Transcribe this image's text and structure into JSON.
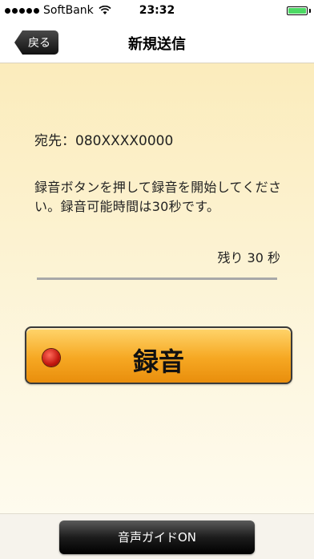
{
  "status_bar": {
    "carrier": "SoftBank",
    "time": "23:32",
    "signal_bars": 5,
    "battery_level": 1.0,
    "battery_color": "#4cd964"
  },
  "nav": {
    "back_label": "戻る",
    "title": "新規送信"
  },
  "main": {
    "recipient": "宛先：080XXXX0000",
    "instructions": "録音ボタンを押して録音を開始してください。録音可能時間は30秒です。",
    "remaining": "残り 30 秒",
    "record_label": "録音"
  },
  "footer": {
    "voice_guide_label": "音声ガイドON"
  },
  "colors": {
    "background": "#fdf3cf",
    "record_button": "#f6a823",
    "record_dot": "#c3170f"
  }
}
